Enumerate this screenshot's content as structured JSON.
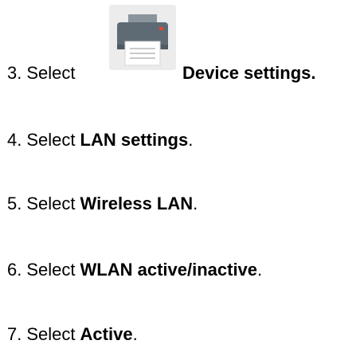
{
  "steps": [
    {
      "number": "3.",
      "prefix": "Select",
      "bold": "Device settings",
      "suffix": ".",
      "icon": "printer-icon"
    },
    {
      "number": "4.",
      "prefix": "Select",
      "bold": "LAN settings",
      "suffix": "."
    },
    {
      "number": "5.",
      "prefix": "Select",
      "bold": "Wireless LAN",
      "suffix": "."
    },
    {
      "number": "6.",
      "prefix": "Select",
      "bold": "WLAN active/inactive",
      "suffix": "."
    },
    {
      "number": "7.",
      "prefix": "Select",
      "bold": "Active",
      "suffix": "."
    }
  ],
  "colors": {
    "text": "#000000",
    "icon_background": "#ececec",
    "printer_body": "#5f6b74",
    "printer_paper": "#ffffff",
    "printer_led": "#e8452f"
  }
}
